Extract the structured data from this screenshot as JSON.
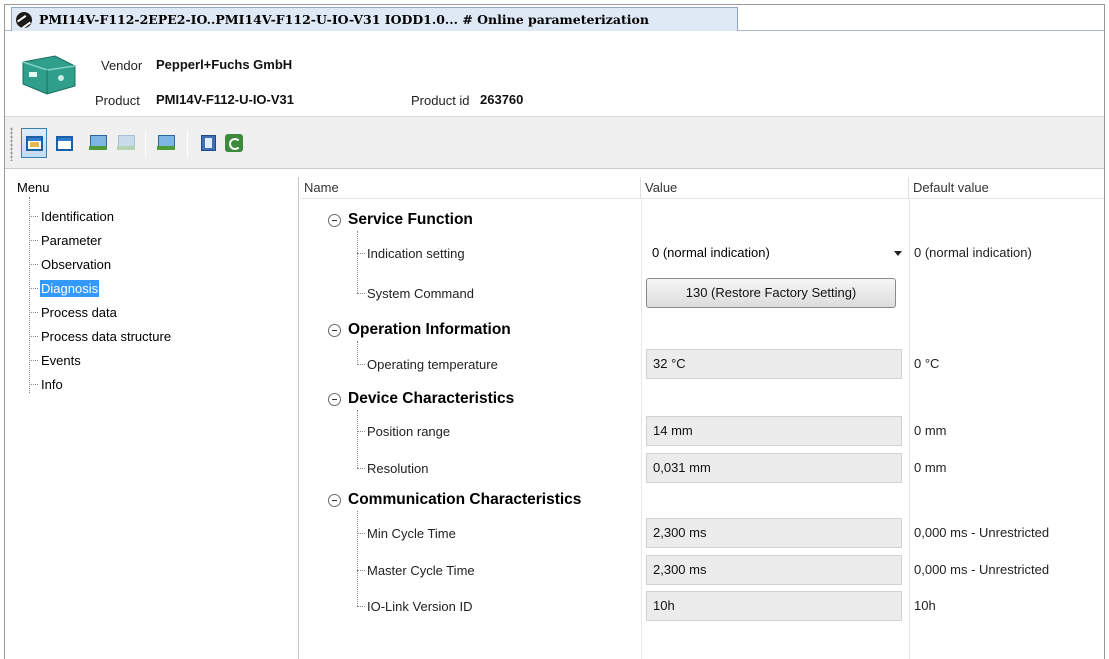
{
  "tab": {
    "title": "PMI14V-F112-2EPE2-IO..PMI14V-F112-U-IO-V31 IODD1.0... # Online parameterization",
    "icon": "device-tool-icon"
  },
  "header": {
    "vendor_label": "Vendor",
    "vendor_value": "Pepperl+Fuchs GmbH",
    "product_label": "Product",
    "product_value": "PMI14V-F112-U-IO-V31",
    "product_id_label": "Product id",
    "product_id_value": "263760"
  },
  "toolbar": {
    "buttons": [
      "window-icon",
      "window-split-icon",
      "upload-device-icon",
      "download-device-icon",
      "device-compare-icon",
      "panel-icon",
      "refresh-icon"
    ]
  },
  "tree": {
    "root": "Menu",
    "items": [
      {
        "label": "Identification"
      },
      {
        "label": "Parameter"
      },
      {
        "label": "Observation"
      },
      {
        "label": "Diagnosis",
        "selected": true
      },
      {
        "label": "Process data"
      },
      {
        "label": "Process data structure"
      },
      {
        "label": "Events"
      },
      {
        "label": "Info"
      }
    ]
  },
  "grid": {
    "columns": {
      "name": "Name",
      "value": "Value",
      "default": "Default value"
    },
    "sections": [
      {
        "title": "Service Function",
        "params": [
          {
            "name": "Indication setting",
            "value": "0 (normal indication)",
            "default": "0 (normal indication)",
            "kind": "dropdown"
          },
          {
            "name": "System Command",
            "value": "130 (Restore Factory Setting)",
            "default": "",
            "kind": "button"
          }
        ]
      },
      {
        "title": "Operation Information",
        "params": [
          {
            "name": "Operating temperature",
            "value": "32 °C",
            "default": "0 °C",
            "kind": "readonly"
          }
        ]
      },
      {
        "title": "Device Characteristics",
        "params": [
          {
            "name": "Position range",
            "value": "14 mm",
            "default": "0 mm",
            "kind": "readonly"
          },
          {
            "name": "Resolution",
            "value": "0,031 mm",
            "default": "0 mm",
            "kind": "readonly"
          }
        ]
      },
      {
        "title": "Communication Characteristics",
        "params": [
          {
            "name": "Min Cycle Time",
            "value": "2,300 ms",
            "default": "0,000 ms - Unrestricted",
            "kind": "readonly"
          },
          {
            "name": "Master Cycle Time",
            "value": "2,300 ms",
            "default": "0,000 ms - Unrestricted",
            "kind": "readonly"
          },
          {
            "name": "IO-Link Version ID",
            "value": "10h",
            "default": "10h",
            "kind": "readonly"
          }
        ]
      }
    ]
  }
}
